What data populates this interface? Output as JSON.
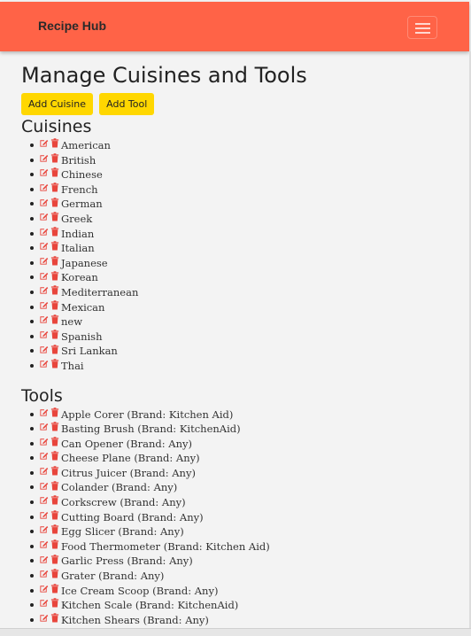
{
  "navbar": {
    "brand": "Recipe Hub",
    "toggler_icon": "hamburger-menu-icon"
  },
  "page": {
    "title": "Manage Cuisines and Tools"
  },
  "buttons": {
    "add_cuisine": "Add Cuisine",
    "add_tool": "Add Tool"
  },
  "cuisines": {
    "heading": "Cuisines",
    "items": [
      "American",
      "British",
      "Chinese",
      "French",
      "German",
      "Greek",
      "Indian",
      "Italian",
      "Japanese",
      "Korean",
      "Mediterranean",
      "Mexican",
      "new",
      "Spanish",
      "Sri Lankan",
      "Thai"
    ]
  },
  "tools": {
    "heading": "Tools",
    "items": [
      "Apple Corer (Brand: Kitchen Aid)",
      "Basting Brush (Brand: KitchenAid)",
      "Can Opener (Brand: Any)",
      "Cheese Plane (Brand: Any)",
      "Citrus Juicer (Brand: Any)",
      "Colander (Brand: Any)",
      "Corkscrew (Brand: Any)",
      "Cutting Board (Brand: Any)",
      "Egg Slicer (Brand: Any)",
      "Food Thermometer (Brand: Kitchen Aid)",
      "Garlic Press (Brand: Any)",
      "Grater (Brand: Any)",
      "Ice Cream Scoop (Brand: Any)",
      "Kitchen Scale (Brand: KitchenAid)",
      "Kitchen Shears (Brand: Any)"
    ]
  },
  "colors": {
    "navbar": "#ff6347",
    "button": "#ffd700",
    "icon": "#e8453c"
  },
  "icons": {
    "edit": "edit-icon",
    "delete": "trash-icon"
  }
}
